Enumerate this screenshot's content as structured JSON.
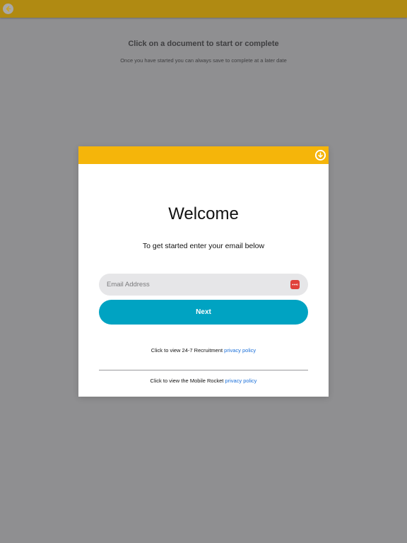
{
  "topbar": {
    "back_icon": "arrow-left-circle-icon"
  },
  "background": {
    "title": "Click on a document to start or complete",
    "subtitle": "Once you have started you can always save to complete at a later date"
  },
  "modal": {
    "collapse_icon": "arrow-down-circle-icon",
    "title": "Welcome",
    "subtitle": "To get started enter your email below",
    "email": {
      "placeholder": "Email Address",
      "value": "",
      "autofill_icon": "password-key-icon"
    },
    "next_label": "Next",
    "policy_1_text": "Click to view 24-7 Recruitment ",
    "policy_1_link": "privacy policy",
    "policy_2_text": "Click to view the Mobile Rocket ",
    "policy_2_link": "privacy policy"
  },
  "colors": {
    "overlay_bg": "#8f8f91",
    "topbar": "#b08a12",
    "modal_header": "#f5b50a",
    "accent": "#00a3c2",
    "link": "#1a6fd9",
    "autofill_icon": "#e0413b"
  }
}
